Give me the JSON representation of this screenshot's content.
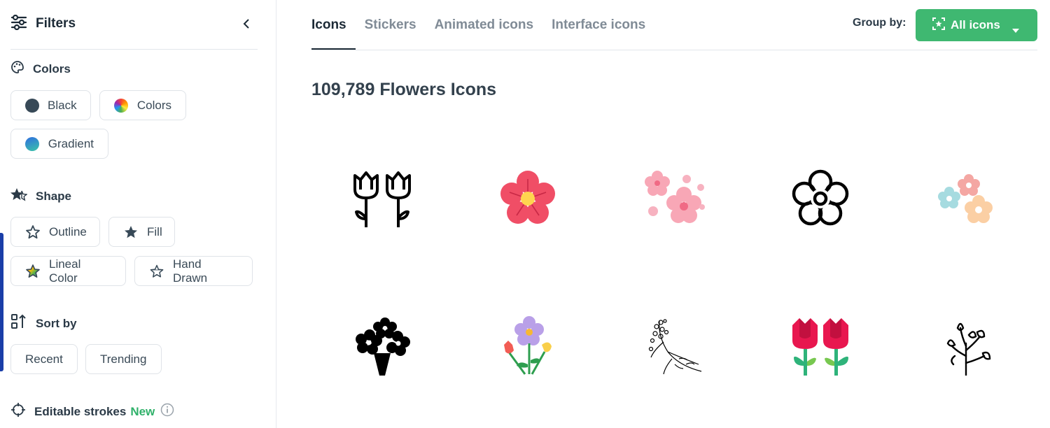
{
  "sidebar": {
    "title": "Filters",
    "colors": {
      "title": "Colors",
      "options": [
        {
          "label": "Black",
          "color": "#374957"
        },
        {
          "label": "Colors"
        },
        {
          "label": "Gradient"
        }
      ]
    },
    "shape": {
      "title": "Shape",
      "options": [
        {
          "label": "Outline"
        },
        {
          "label": "Fill"
        },
        {
          "label": "Lineal Color"
        },
        {
          "label": "Hand Drawn"
        }
      ]
    },
    "sort": {
      "title": "Sort by",
      "options": [
        {
          "label": "Recent"
        },
        {
          "label": "Trending"
        }
      ]
    },
    "editable": {
      "title": "Editable strokes",
      "badge": "New"
    }
  },
  "main": {
    "tabs": [
      {
        "label": "Icons",
        "active": true
      },
      {
        "label": "Stickers"
      },
      {
        "label": "Animated icons"
      },
      {
        "label": "Interface icons"
      }
    ],
    "group_by_label": "Group by:",
    "group_by_value": "All icons",
    "heading": "109,789 Flowers Icons",
    "icons": [
      "tulips-outline-icon",
      "flower-pink-icon",
      "cherry-blossom-icon",
      "flower-outline-icon",
      "pastel-flowers-icon",
      "bouquet-fill-icon",
      "bouquet-color-icon",
      "branch-hand-drawn-icon",
      "tulips-color-icon",
      "flower-branch-line-icon"
    ]
  },
  "colors": {
    "accent": "#3fb871",
    "new": "#30b16a",
    "sidebar_accent": "#1a3ea8"
  }
}
